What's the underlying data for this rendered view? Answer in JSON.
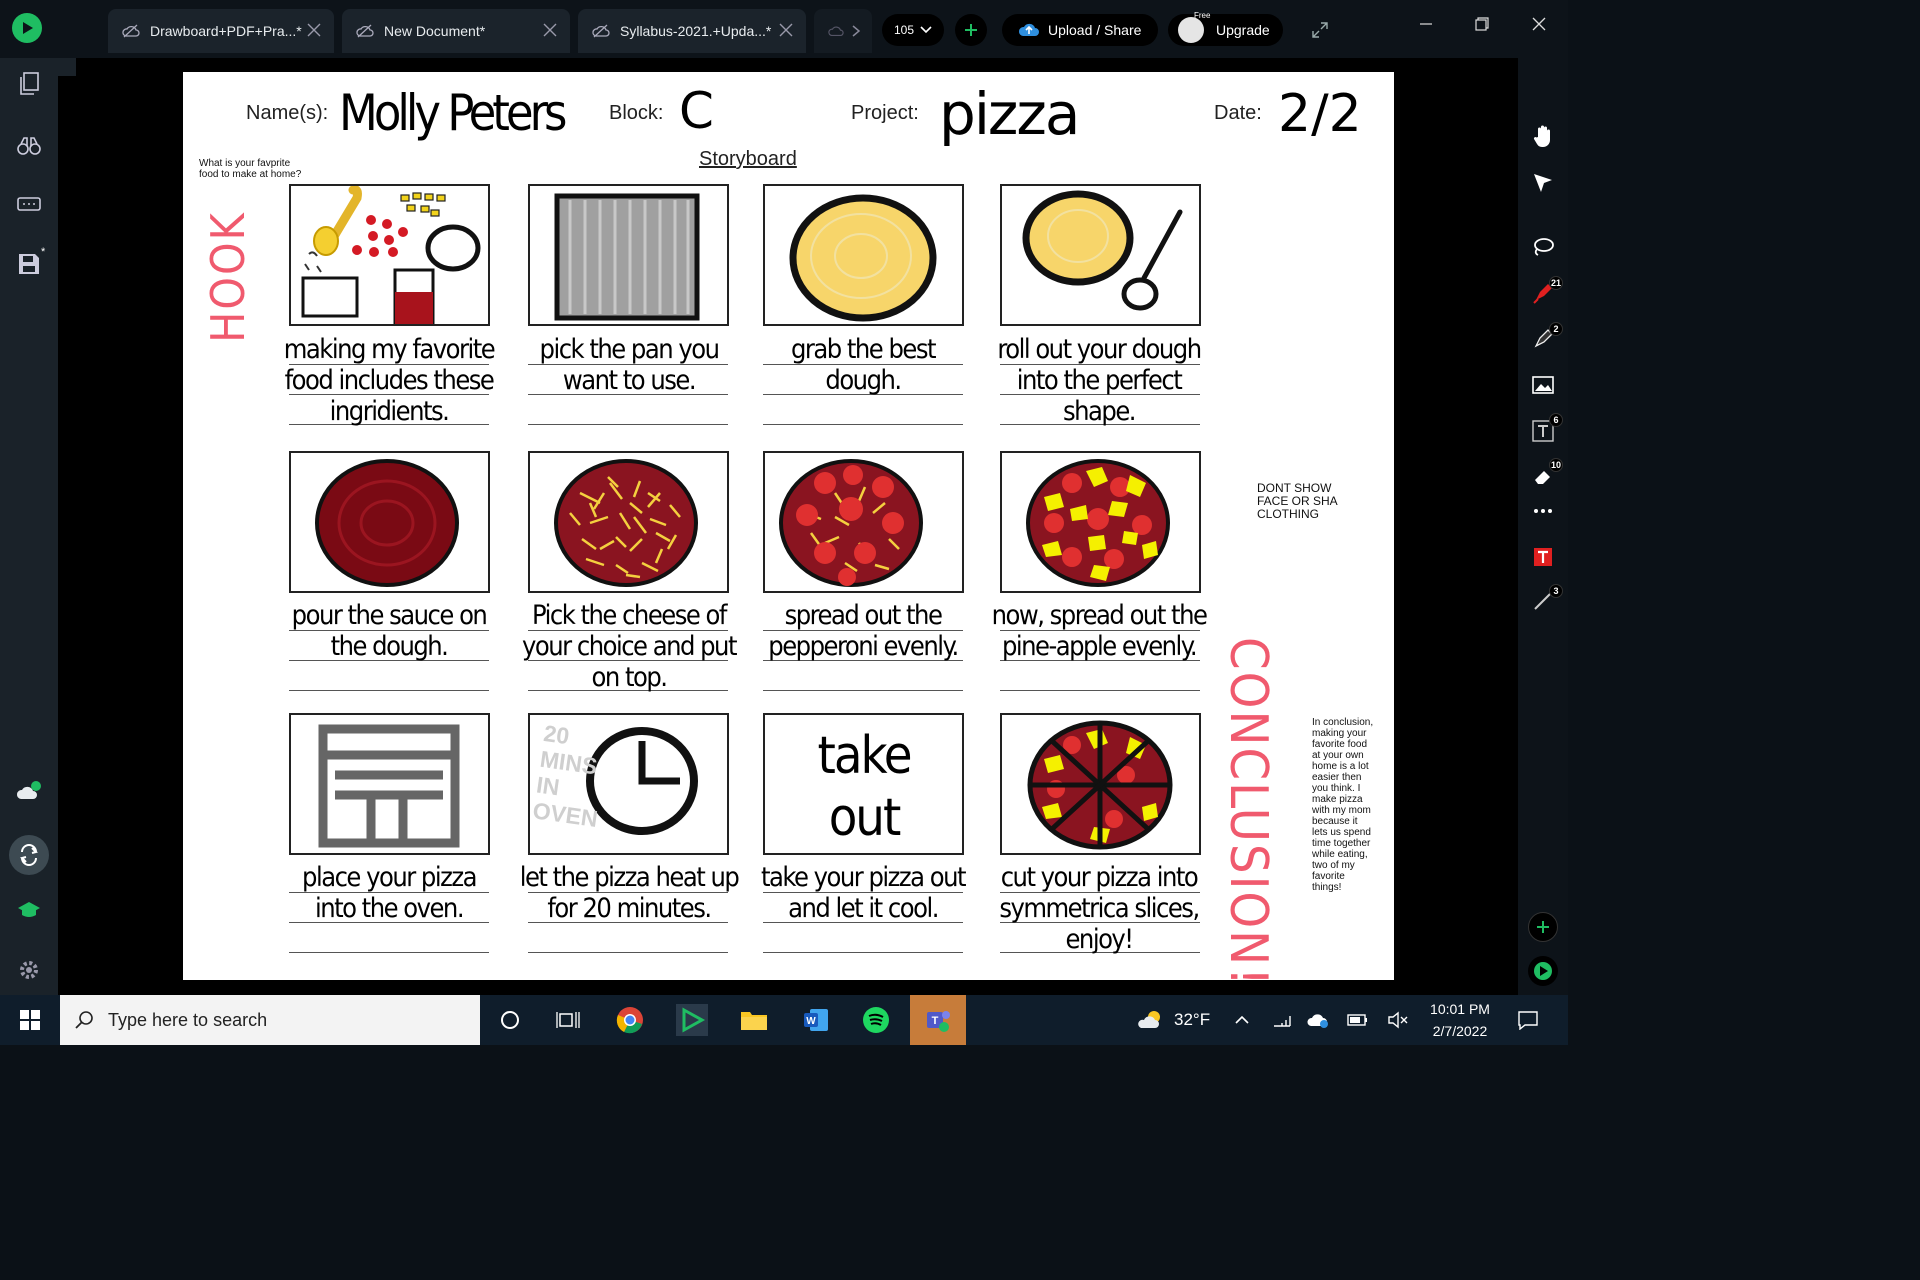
{
  "tabs": [
    {
      "label": "Drawboard+PDF+Pra...*"
    },
    {
      "label": "New Document*"
    },
    {
      "label": "Syllabus-2021.+Upda...*"
    }
  ],
  "toolbar": {
    "zoom": "105",
    "upload_share": "Upload / Share",
    "upgrade": "Upgrade",
    "free_tag": "Free"
  },
  "right_rail": {
    "badges": [
      "21",
      "2",
      "6",
      "10",
      "3"
    ]
  },
  "document": {
    "header": {
      "name_label": "Name(s):",
      "name_value": "Molly Peters",
      "block_label": "Block:",
      "block_value": "C",
      "project_label": "Project:",
      "project_value": "pizza",
      "date_label": "Date:",
      "date_value": "2/2",
      "subtitle": "Storyboard"
    },
    "hook_question": "What is your favprite food to make at home?",
    "hook_label": "HOOK",
    "conclusion_label": "CONCLUSION!",
    "side_note": "DONT SHOW FACE OR SHA CLOTHING",
    "conclusion_text": "In conclusion, making your favorite food at your own home is a lot easier then you think. I make pizza with my mom because it lets us spend time together while eating, two of my favorite things!",
    "panels": [
      {
        "caption": "making my favorite food includes these ingridients."
      },
      {
        "caption": "pick the pan you want to use."
      },
      {
        "caption": "grab the best dough."
      },
      {
        "caption": "roll out your dough into the perfect shape."
      },
      {
        "caption": "pour the sauce on the dough."
      },
      {
        "caption": "Pick the cheese of your choice and put on top."
      },
      {
        "caption": "spread out the pepperoni evenly."
      },
      {
        "caption": "now, spread out the pine-apple evenly."
      },
      {
        "caption": "place your pizza into the oven."
      },
      {
        "caption": "let the pizza heat up for 20 minutes."
      },
      {
        "caption": "take your pizza out and let it cool."
      },
      {
        "caption": "cut your pizza into symmetrica slices, enjoy!"
      }
    ],
    "panel_texts": {
      "timer": "20 MINS IN OVEN",
      "take_out": "take out"
    }
  },
  "taskbar": {
    "search_placeholder": "Type here to search",
    "weather": "32°F",
    "time": "10:01 PM",
    "date": "2/7/2022"
  },
  "colors": {
    "accent": "#1fbd62",
    "sauce": "#7a0a14",
    "cheese": "#f4d03f",
    "pineapple": "#f5f000",
    "pepperoni": "#d62828",
    "red_ink": "#f05a6e"
  }
}
